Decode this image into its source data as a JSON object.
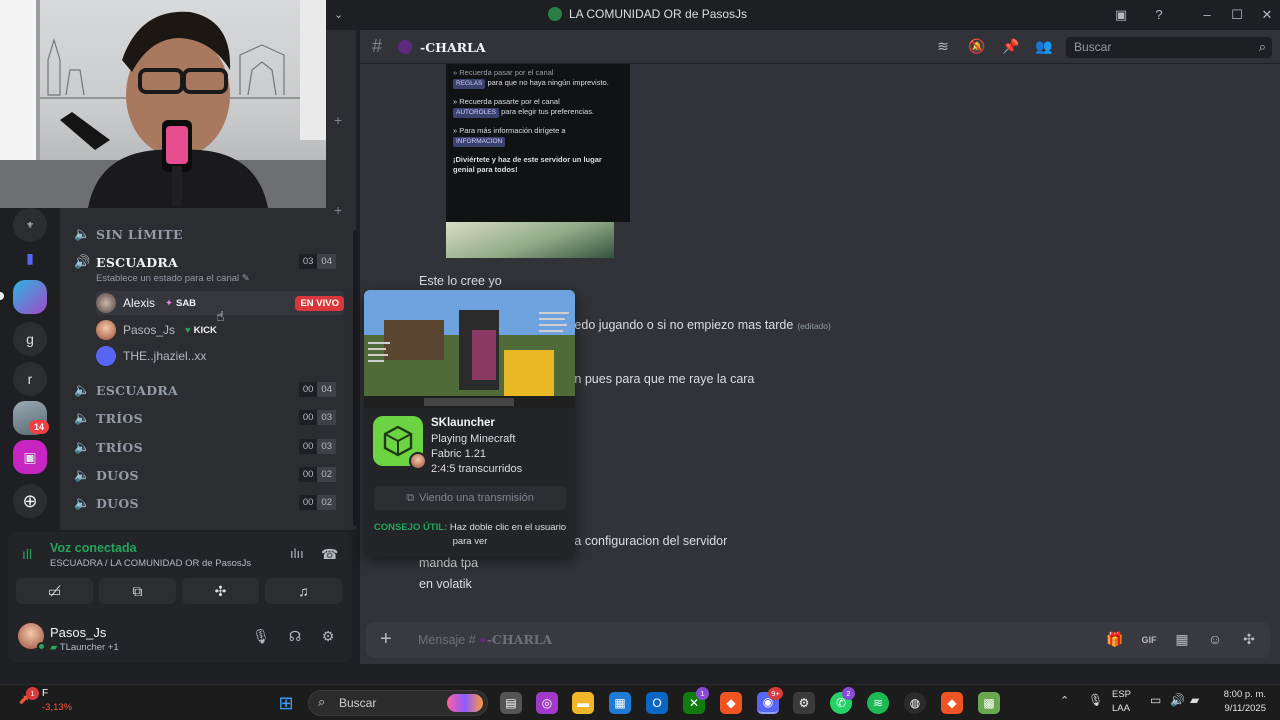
{
  "window": {
    "title": "LA COMUNIDAD OR de PasosJs"
  },
  "server_rail": {
    "letters": [
      "g",
      "r"
    ],
    "mention_badge": "14"
  },
  "sidebar": {
    "channels": [
      {
        "name": "SIN LÍMITE"
      },
      {
        "name": "ESCUADRA",
        "status": "Establece un estado para el canal",
        "count": "03",
        "limit": "04"
      },
      {
        "name": "ESCUADRA",
        "count": "00",
        "limit": "04"
      },
      {
        "name": "TRÍOS",
        "count": "00",
        "limit": "03"
      },
      {
        "name": "TRÍOS",
        "count": "00",
        "limit": "03"
      },
      {
        "name": "DUOS",
        "count": "00",
        "limit": "02"
      },
      {
        "name": "DUOS",
        "count": "00",
        "limit": "02"
      }
    ],
    "users": [
      {
        "name": "Alexis",
        "tag": "SAB",
        "live": "EN VIVO"
      },
      {
        "name": "Pasos_Js",
        "tag": "KICK"
      },
      {
        "name": "THE..jhaziel..xx"
      }
    ]
  },
  "voice": {
    "status": "Voz conectada",
    "location": "ESCUADRA / LA COMUNIDAD OR de PasosJs"
  },
  "user_panel": {
    "username": "Pasos_Js",
    "activity": "TLauncher +1"
  },
  "header": {
    "channel_name": "-CHARLA",
    "search_placeholder": "Buscar"
  },
  "embed": {
    "line1": "para que no haya ningún imprevisto.",
    "chip_reglas": "REGLAS",
    "line2a": "» Recuerda pasarte por el canal",
    "chip_autoroles": "AUTOROLES",
    "line2b": "para elegir tus preferencias.",
    "line3": "» Para más información dirígete a",
    "chip_info": "INFORMACION",
    "line4": "¡Diviértete y haz de este servidor un lugar genial para todos!"
  },
  "messages": [
    {
      "text": "Este lo cree yo"
    },
    {
      "text": "...edo jugando o si no empiezo mas tarde",
      "edited": "(editado)"
    },
    {
      "text": "...n pues para que me raye la cara"
    },
    {
      "text": "...a configuracion del servidor"
    },
    {
      "text": "manda tpa"
    },
    {
      "text": "en volatik"
    }
  ],
  "composer": {
    "placeholder_prefix": "Mensaje #",
    "placeholder_channel": "-CHARLA"
  },
  "popout": {
    "app_name": "SKlauncher",
    "line2": "Playing Minecraft",
    "line3": "Fabric 1.21",
    "line4": "2:4:5 transcurridos",
    "watch": "Viendo una transmisión",
    "tip_label": "CONSEJO ÚTIL:",
    "tip_text": "Haz doble clic en el usuario para ver"
  },
  "taskbar": {
    "search_placeholder": "Buscar",
    "stock_name": "F",
    "stock_change": "-3,13%",
    "lang": "ESP",
    "layout": "LAA",
    "time": "8:00 p. m.",
    "date": "9/11/2025",
    "discord_badge": "9+",
    "whatsapp_badge": "2",
    "xbox_badge": "1",
    "stock_badge": "1"
  },
  "colors": {
    "accent_green": "#23a55a",
    "live_red": "#da373c",
    "background": "#313338"
  }
}
